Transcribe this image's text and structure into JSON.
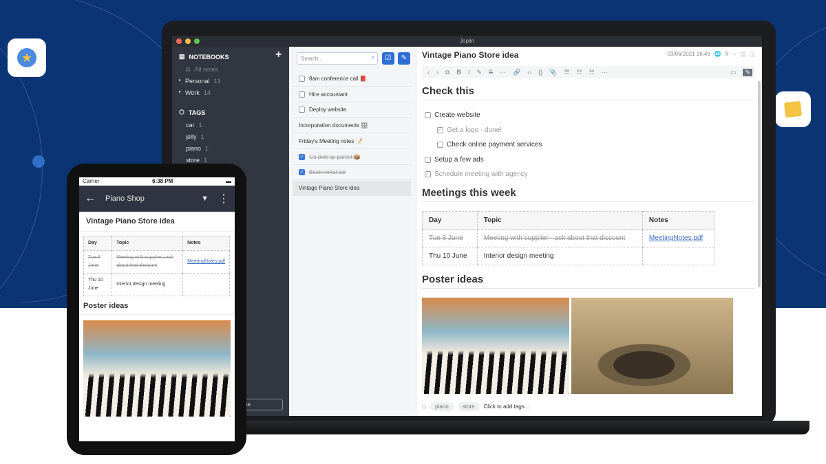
{
  "app_title": "Joplin",
  "sidebar": {
    "notebooks_label": "NOTEBOOKS",
    "add_label": "+",
    "all_notes": "All notes",
    "notebooks": [
      {
        "label": "Personal",
        "count": "13"
      },
      {
        "label": "Work",
        "count": "14"
      }
    ],
    "tags_label": "TAGS",
    "tags": [
      {
        "label": "car",
        "count": "1"
      },
      {
        "label": "jelly",
        "count": "1"
      },
      {
        "label": "piano",
        "count": "1"
      },
      {
        "label": "store",
        "count": "1"
      }
    ],
    "sync_button": "Synchronise"
  },
  "notelist": {
    "search_placeholder": "Search...",
    "notes": [
      {
        "title": "8am conference call 📕",
        "todo": true,
        "done": false
      },
      {
        "title": "Hire accountant",
        "todo": true,
        "done": false
      },
      {
        "title": "Deploy website",
        "todo": true,
        "done": false
      },
      {
        "title": "Incorporation documents 🗄",
        "todo": false,
        "done": false
      },
      {
        "title": "Friday's Meeting notes 📝",
        "todo": false,
        "done": false
      },
      {
        "title": "Go pick up parcel 📦",
        "todo": true,
        "done": true
      },
      {
        "title": "Book rental car",
        "todo": true,
        "done": true
      },
      {
        "title": "Vintage Piano Store idea",
        "todo": false,
        "done": false
      }
    ]
  },
  "editor": {
    "title": "Vintage Piano Store idea",
    "date": "03/06/2021 16:49",
    "lang": "fr",
    "h_check": "Check this",
    "checklist": [
      {
        "label": "Create website",
        "done": false
      },
      {
        "label": "Get a logo - done!",
        "done": true
      },
      {
        "label": "Check online payment services",
        "done": false
      },
      {
        "label": "Setup a few ads",
        "done": false
      },
      {
        "label": "Schedule meeting with agency",
        "done": true
      }
    ],
    "h_meetings": "Meetings this week",
    "table": {
      "headers": [
        "Day",
        "Topic",
        "Notes"
      ],
      "rows": [
        [
          "Tue 8 June",
          "Meeting with supplier - ask about that discount",
          "MeetingNotes.pdf"
        ],
        [
          "Thu 10 June",
          "Interior design meeting",
          ""
        ]
      ]
    },
    "h_poster": "Poster ideas",
    "tags": [
      "piano",
      "store"
    ],
    "add_tags": "Click to add tags..."
  },
  "phone": {
    "carrier": "Carrier",
    "time": "6:38 PM",
    "notebook": "Piano Shop",
    "note_title": "Vintage Piano Store Idea",
    "poster": "Poster ideas"
  },
  "colors": {
    "brand_blue": "#0b3474",
    "accent": "#2e6fd6"
  }
}
